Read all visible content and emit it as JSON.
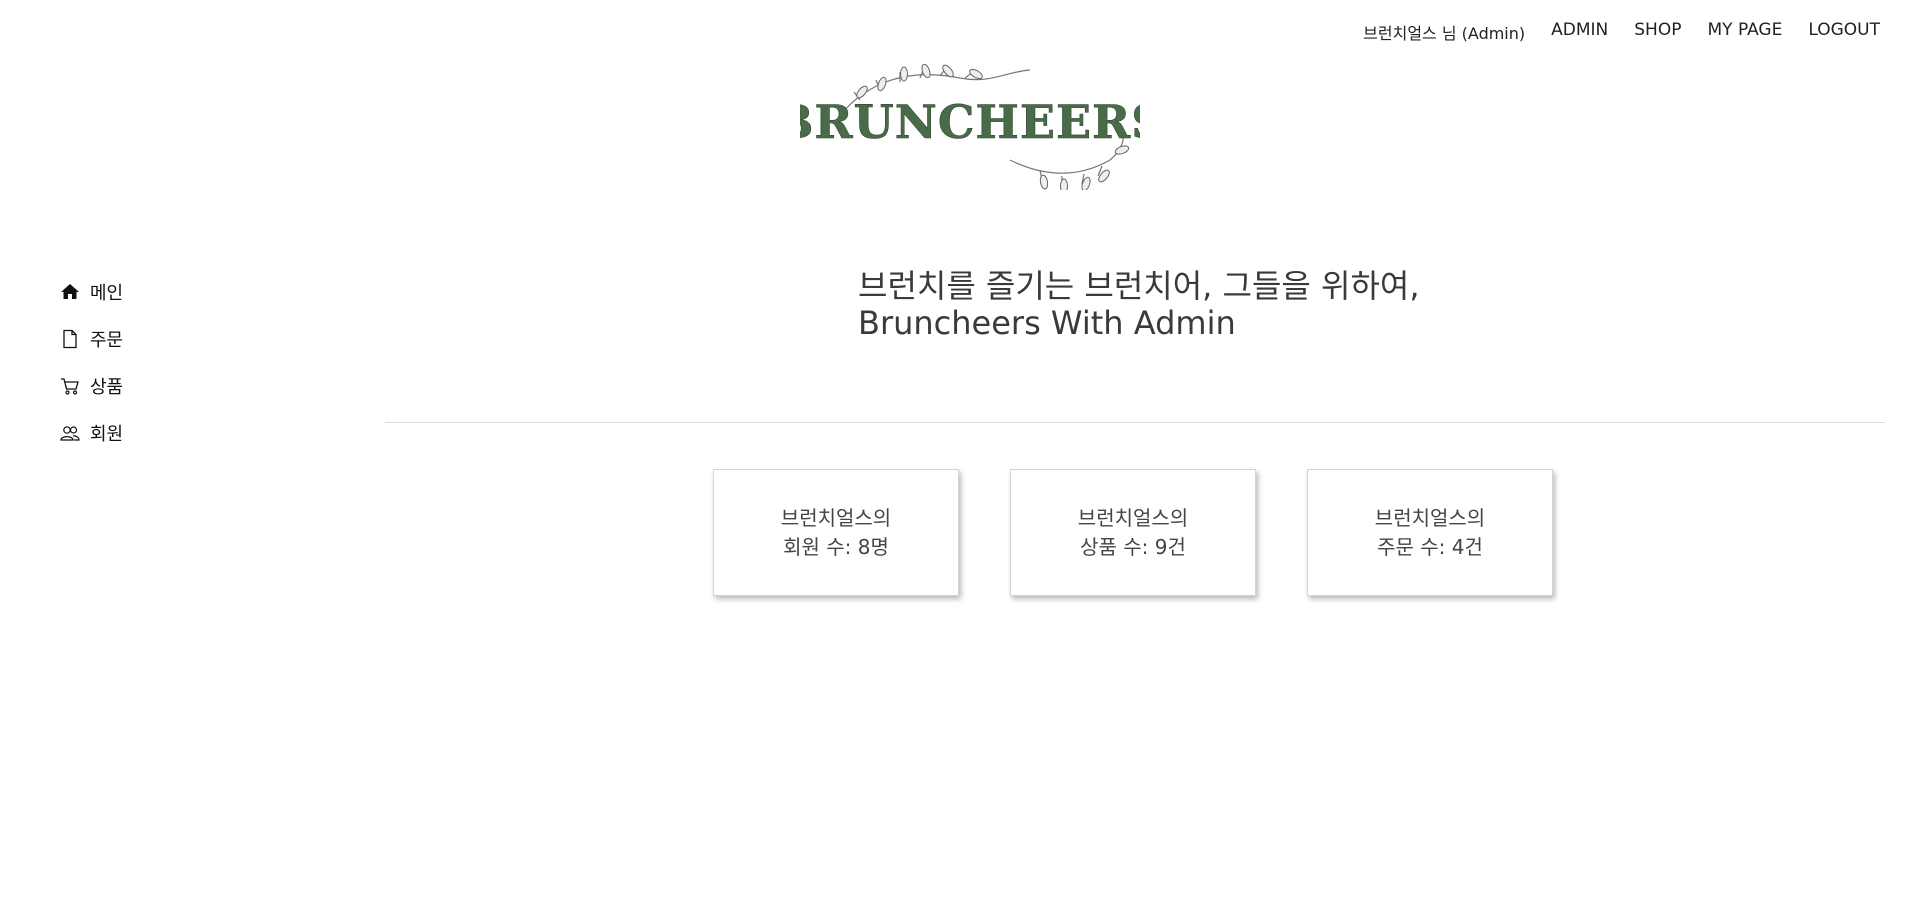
{
  "topnav": {
    "user": "브런치얼스 님 (Admin)",
    "admin": "ADMIN",
    "shop": "SHOP",
    "mypage": "MY PAGE",
    "logout": "LOGOUT"
  },
  "logo": {
    "text": "BRUNCHEERS",
    "color": "#4a6b4a"
  },
  "sidebar": {
    "items": [
      {
        "label": "메인",
        "icon": "home-icon"
      },
      {
        "label": "주문",
        "icon": "document-icon"
      },
      {
        "label": "상품",
        "icon": "cart-icon"
      },
      {
        "label": "회원",
        "icon": "users-icon"
      }
    ]
  },
  "headline": {
    "line1": "브런치를 즐기는 브런치어, 그들을 위하여,",
    "line2": "Bruncheers With Admin"
  },
  "cards": [
    {
      "line1": "브런치얼스의",
      "line2": "회원 수: 8명"
    },
    {
      "line1": "브런치얼스의",
      "line2": "상품 수: 9건"
    },
    {
      "line1": "브런치얼스의",
      "line2": "주문 수: 4건"
    }
  ]
}
